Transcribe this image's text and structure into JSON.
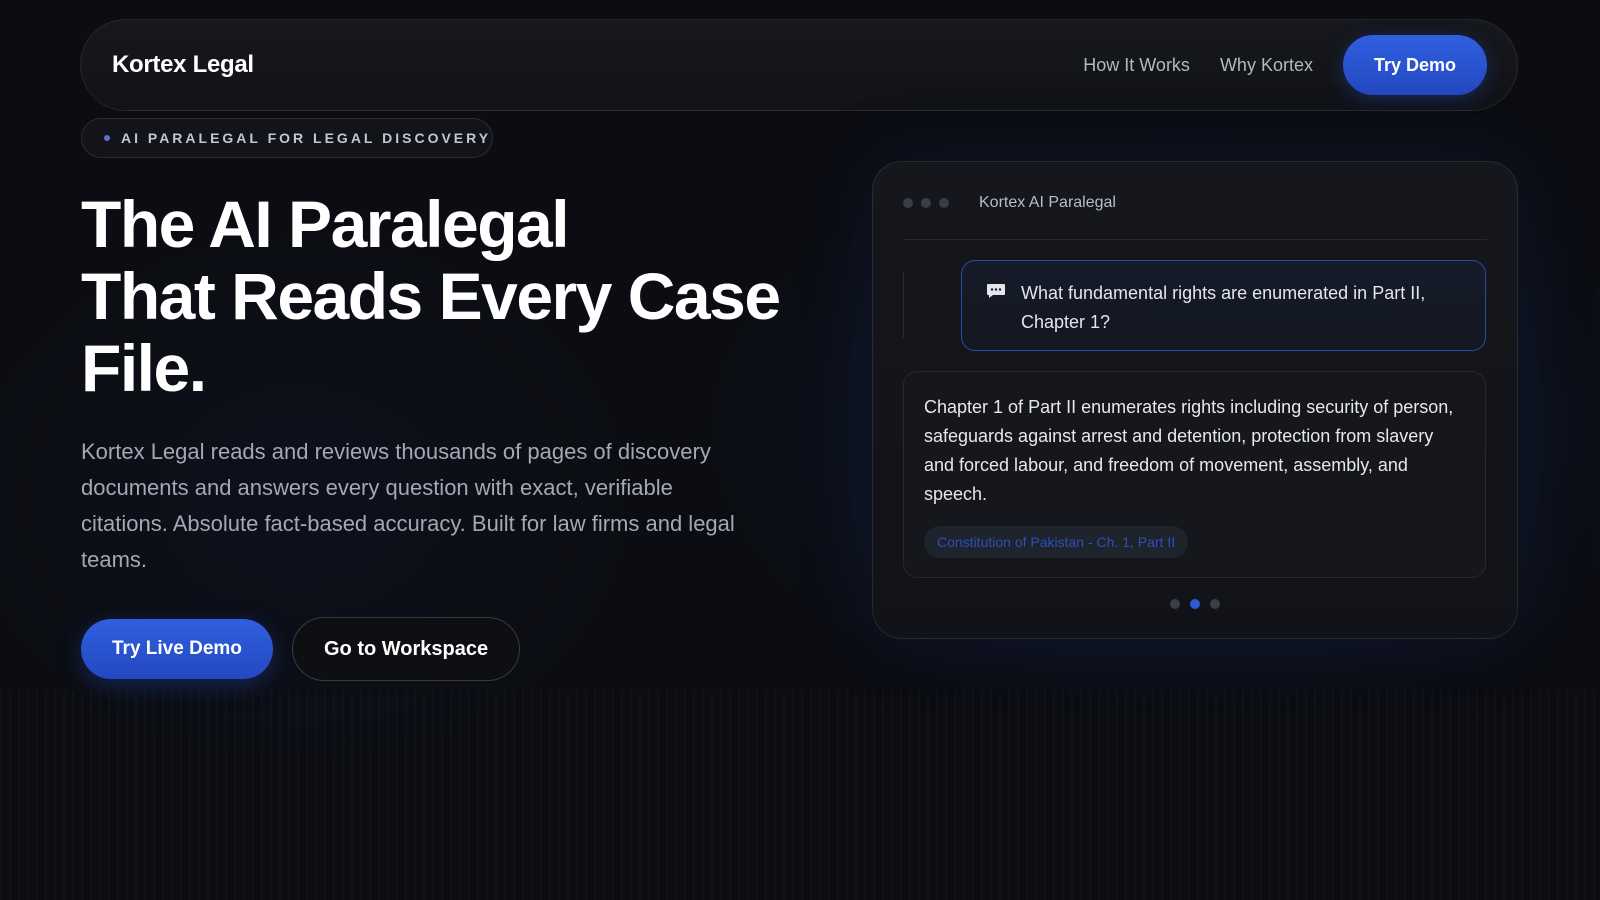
{
  "nav": {
    "brand": "Kortex Legal",
    "links": [
      "How It Works",
      "Why Kortex"
    ],
    "cta_label": "Try Demo"
  },
  "badge": {
    "text": "AI PARALEGAL FOR LEGAL DISCOVERY"
  },
  "hero": {
    "title_lines": [
      "The AI Paralegal",
      "That Reads Every Case",
      "File."
    ],
    "description": "Kortex Legal reads and reviews thousands of pages of discovery documents and answers every question with exact, verifiable citations. Absolute fact-based accuracy. Built for law firms and legal teams.",
    "primary_button": "Try Live Demo",
    "secondary_button": "Go to Workspace"
  },
  "chat": {
    "title": "Kortex AI Paralegal",
    "question": "What fundamental rights are enumerated in Part II, Chapter 1?",
    "answer": "Chapter 1 of Part II enumerates rights including security of person, safeguards against arrest and detention, protection from slavery and forced labour, and freedom of movement, assembly, and speech.",
    "citation": "Constitution of Pakistan - Ch. 1, Part II",
    "pager": {
      "total": 3,
      "active_index": 1
    }
  },
  "icons": {
    "window_dots": "window-dots-icon",
    "question": "chat-bubble-icon",
    "badge": "status-dot-icon"
  },
  "colors": {
    "background": "#0b0d12",
    "accent": "#2d58d8",
    "question_border": "#2a4aa8",
    "citation_text": "#2c4fb8"
  }
}
